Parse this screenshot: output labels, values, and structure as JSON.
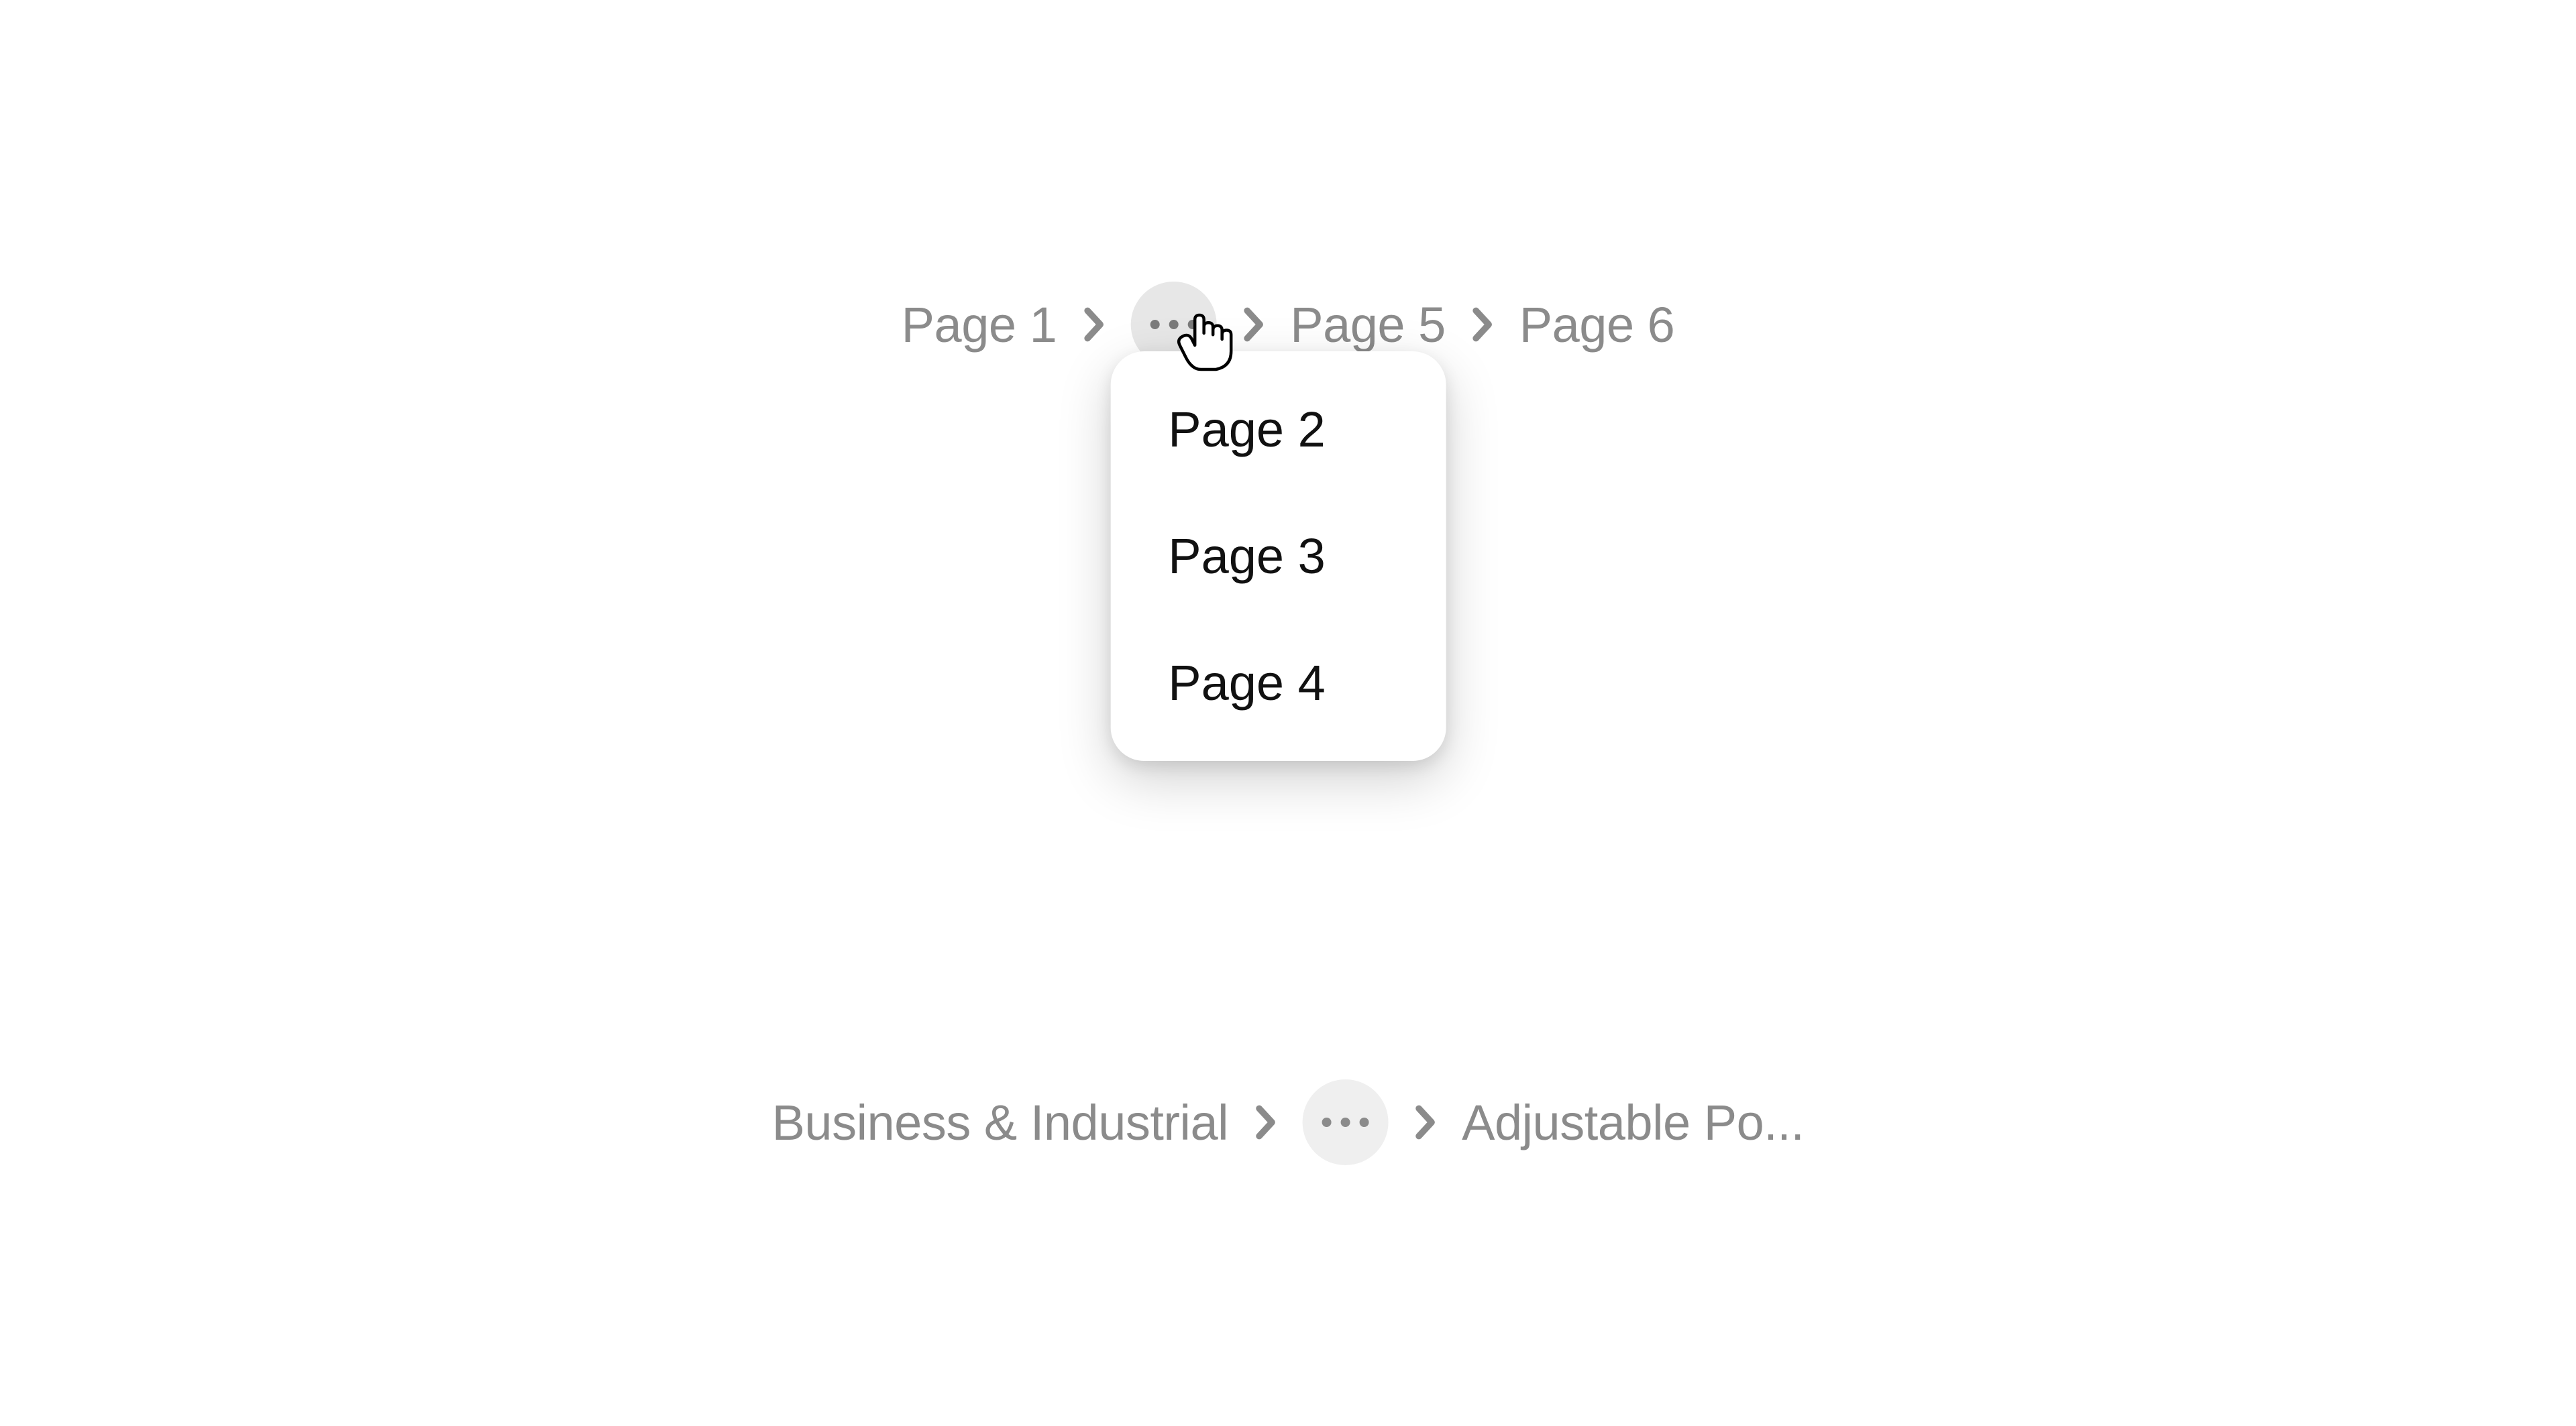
{
  "breadcrumb1": {
    "first": "Page 1",
    "overflow_items": [
      "Page 2",
      "Page 3",
      "Page 4"
    ],
    "after1": "Page 5",
    "after2": "Page 6"
  },
  "breadcrumb2": {
    "first": "Business & Industrial",
    "last": "Adjustable Po..."
  }
}
